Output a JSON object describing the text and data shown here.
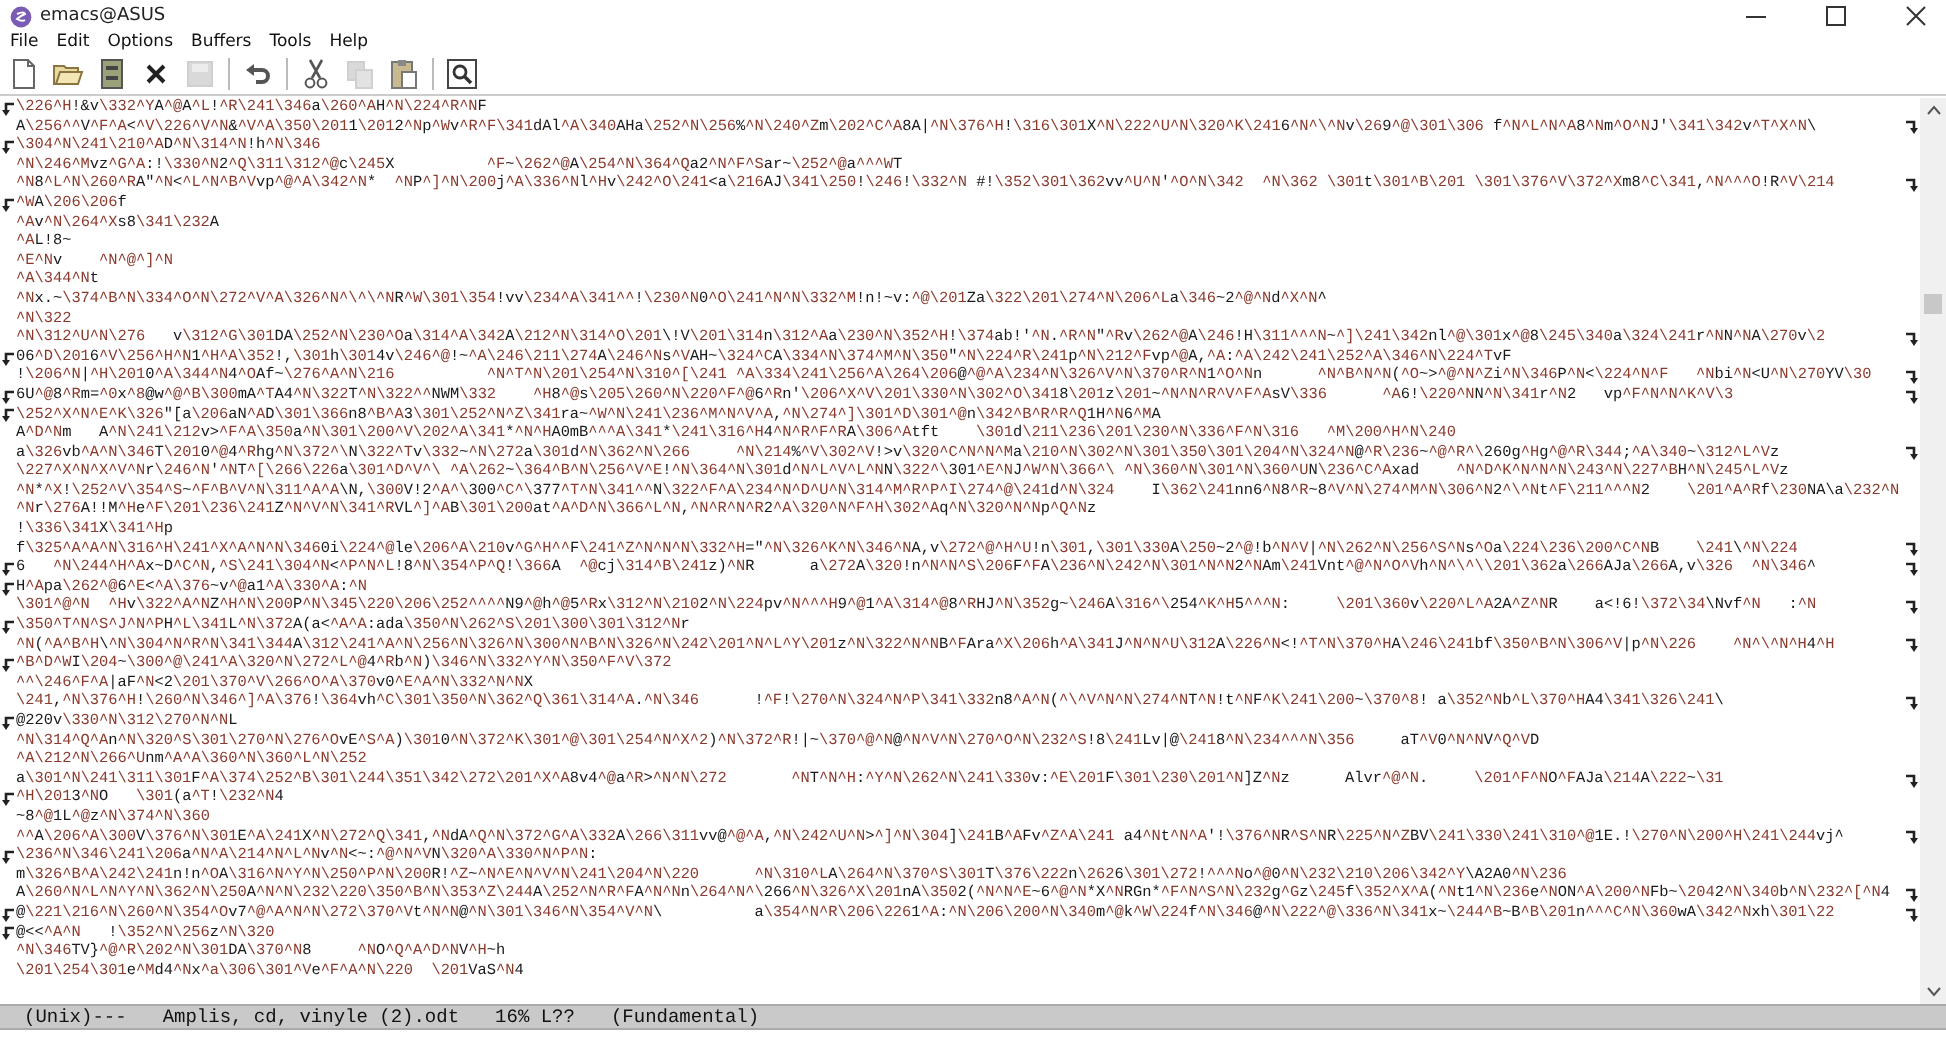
{
  "window": {
    "title": "emacs@ASUS"
  },
  "menu": [
    "File",
    "Edit",
    "Options",
    "Buffers",
    "Tools",
    "Help"
  ],
  "toolbar": [
    [
      {
        "kind": "new-file",
        "disabled": false
      },
      {
        "kind": "open",
        "disabled": false
      },
      {
        "kind": "dired",
        "disabled": false
      },
      {
        "kind": "kill",
        "disabled": false
      },
      {
        "kind": "save",
        "disabled": true
      }
    ],
    [
      {
        "kind": "undo",
        "disabled": false
      }
    ],
    [
      {
        "kind": "cut",
        "disabled": false
      },
      {
        "kind": "copy",
        "disabled": true
      },
      {
        "kind": "paste",
        "disabled": false
      }
    ],
    [
      {
        "kind": "search",
        "disabled": false
      }
    ]
  ],
  "buffer": {
    "lines": [
      {
        "text": "\\226^H!&v\\332^YA^@A^L!^R\\241\\346a\\260^AH^N\\224^R^NF",
        "wrap_left": true,
        "wrap_right": false
      },
      {
        "text": "A\\256^^V^F^A<^V\\226^V^N&^V^A\\350\\2011\\2012^Np^Wv^R^F\\341dAl^A\\340AHa\\252^N\\256%^N\\240^Zm\\202^C^A8A|^N\\376^H!\\316\\301X^N\\222^U^N\\320^K\\2416^N^\\^Nv\\269^@\\301\\306 f^N^L^N^A8^Nm^O^NJ'\\341\\342v^T^X^N\\",
        "wrap_left": false,
        "wrap_right": true
      },
      {
        "text": "\\304^N\\241\\210^AD^N\\314^N!h^N\\346",
        "wrap_left": true,
        "wrap_right": false
      },
      {
        "text": "^N\\246^Mvz^G^A:!\\330^N2^Q\\311\\312^@c\\245X          ^F~\\262^@A\\254^N\\364^Qa2^N^F^Sar~\\252^@a^^^WT",
        "wrap_left": false,
        "wrap_right": false
      },
      {
        "text": "^N8^L^N\\260^RA\"^N<^L^N^B^Vvp^@^A\\342^N*  ^NP^]^N\\200j^A\\336^Nl^Hv\\242^O\\241<a\\216AJ\\341\\250!\\246!\\332^N #!\\352\\301\\362vv^U^N'^O^N\\342  ^N\\362 \\301t\\301^B\\201 \\301\\376^V\\372^Xm8^C\\341,^N^^^O!R^V\\214",
        "wrap_left": false,
        "wrap_right": true
      },
      {
        "text": "^WA\\206\\206f",
        "wrap_left": true,
        "wrap_right": false
      },
      {
        "text": "^Av^N\\264^Xs8\\341\\232A",
        "wrap_left": false,
        "wrap_right": false
      },
      {
        "text": "^AL!8~",
        "wrap_left": false,
        "wrap_right": false
      },
      {
        "text": "^E^Nv    ^N^@^]^N",
        "wrap_left": false,
        "wrap_right": false
      },
      {
        "text": "^A\\344^Nt",
        "wrap_left": false,
        "wrap_right": false
      },
      {
        "text": "^Nx.~\\374^B^N\\334^O^N\\272^V^A\\326^N^\\^\\^NR^W\\301\\354!vv\\234^A\\341^^!\\230^N0^O\\241^N^N\\332^M!n!~v:^@\\201Za\\322\\201\\274^N\\206^La\\346~2^@^Nd^X^N^",
        "wrap_left": false,
        "wrap_right": false
      },
      {
        "text": "^N\\322",
        "wrap_left": false,
        "wrap_right": false
      },
      {
        "text": "^N\\312^U^N\\276   v\\312^G\\301DA\\252^N\\230^Oa\\314^A\\342A\\212^N\\314^O\\201\\!V\\201\\314n\\312^Aa\\230^N\\352^H!\\374ab!'^N.^R^N\"^Rv\\262^@A\\246!H\\311^^^N~^]\\241\\342nl^@\\301x^@8\\245\\340a\\324\\241r^NN^NA\\270v\\2",
        "wrap_left": false,
        "wrap_right": true
      },
      {
        "text": "06^D\\2016^V\\256^H^N1^H^A\\352!,\\301h\\3014v\\246^@!~^A\\246\\211\\274A\\246^Ns^VAH~\\324^CA\\334^N\\374^M^N\\350\"^N\\224^R\\241p^N\\212^Fvp^@A,^A:^A\\242\\241\\252^A\\346^N\\224^TvF",
        "wrap_left": true,
        "wrap_right": false
      },
      {
        "text": "!\\206^N|^H\\2010^A\\344^N4^OAf~\\276^A^N\\216          ^N^T^N\\201\\254^N\\310^[\\241 ^A\\334\\241\\256^A\\264\\206@^@^A\\234^N\\326^V^N\\370^R^N1^O^Nn      ^N^B^N^N(^O~>^@^N^Zi^N\\346P^N<\\224^N^F   ^Nbi^N<U^N\\270YV\\30",
        "wrap_left": false,
        "wrap_right": true
      },
      {
        "text": "6U^@8^Rm=^0x^8@w^@^B\\300mA^TA4^N\\322T^N\\322^^NWM\\332    ^H8^@s\\205\\260^N\\220^F^@6^Rn'\\206^X^V\\201\\330^N\\302^O\\3418\\201z\\201~^N^N^R^V^F^AsV\\336      ^A6!\\220^NN^N\\341r^N2   vp^F^N^N^K^V\\3",
        "wrap_left": true,
        "wrap_right": true
      },
      {
        "text": "\\252^X^N^E^K\\326\"[a\\206aN^AD\\301\\366n8^B^A3\\301\\252^N^Z\\341ra~^W^N\\241\\236^M^N^V^A,^N\\274^]\\301^D\\301^@n\\342^B^R^R^Q1H^N6^MA",
        "wrap_left": true,
        "wrap_right": false
      },
      {
        "text": "A^D^Nm   A^N\\241\\212v>^F^A\\350a^N\\301\\200^V\\202^A\\341*^N^HA0mB^^^A\\341*\\241\\316^H4^N^R^F^RA\\306^Atft    \\301d\\211\\236\\201\\230^N\\336^F^N\\316   ^M\\200^H^N\\240",
        "wrap_left": false,
        "wrap_right": false
      },
      {
        "text": "a\\326vb^A^N\\346T\\2010^@4^Rhg^N\\372^\\N\\322^Tv\\332~^N\\272a\\301d^N\\362^N\\266     ^N\\214%^V\\302^V!>v\\320^C^N^N^Ma\\210^N\\302^N\\301\\350\\301\\204^N\\324^N@^R\\236~^@^R^\\260g^Hg^@^R\\344;^A\\340~\\312^L^Vz",
        "wrap_left": false,
        "wrap_right": true
      },
      {
        "text": "\\227^X^N^X^V^Nr\\246^N'^NT^[\\266\\226a\\301^D^V^\\ ^A\\262~\\364^B^N\\256^V^E!^N\\364^N\\301d^N^L^V^L^NN\\322^\\301^E^NJ^W^N\\366^\\ ^N\\360^N\\301^N\\360^UN\\236^C^Axad    ^N^D^K^N^N^N\\243^N\\227^BH^N\\245^L^Vz",
        "wrap_left": false,
        "wrap_right": false
      },
      {
        "text": "^N*^X!\\252^V\\354^S~^F^B^V^N\\311^A^A\\N,\\300V!2^A^\\300^C^\\377^T^N\\341^^N\\322^F^A\\234^N^D^U^N\\314^M^R^P^I\\274^@\\241d^N\\324    I\\362\\241nn6^N8^R~8^V^N\\274^M^N\\306^N2^\\^Nt^F\\211^^^N2    \\201^A^Rf\\230NA\\a\\232^N",
        "wrap_left": false,
        "wrap_right": false
      },
      {
        "text": "^Nr\\276A!!M^He^F\\201\\236\\241Z^N^V^N\\341^RVL^]^AB\\301\\200at^A^D^N\\366^L^N,^N^R^N^R2^A\\320^N^F^H\\302^Aq^N\\320^N^Np^Q^Nz",
        "wrap_left": false,
        "wrap_right": false
      },
      {
        "text": "!\\336\\341X\\341^Hp",
        "wrap_left": false,
        "wrap_right": false
      },
      {
        "text": "f\\325^A^A^N\\316^H\\241^X^A^N^N\\3460i\\224^@le\\206^A\\210v^G^H^^F\\241^Z^N^N^N\\332^H=\"^N\\326^K^N\\346^NA,v\\272^@^H^U!n\\301,\\301\\330A\\250~2^@!b^N^V|^N\\262^N\\256^S^Ns^Oa\\224\\236\\200^C^NB    \\241\\^N\\224",
        "wrap_left": false,
        "wrap_right": true
      },
      {
        "text": "6   ^N\\244^H^Ax~D^C^N,^S\\241\\304^N<^P^N^L!8^N\\354^P^Q!\\366A  ^@cj\\314^B\\241z)^NR      a\\272A\\320!n^N^N^S\\206F^FA\\236^N\\242^N\\301^N^N2^NAm\\241Vnt^@^N^O^Vh^N^\\^\\\\201\\362a\\266AJa\\266A,v\\326  ^N\\346^",
        "wrap_left": true,
        "wrap_right": true
      },
      {
        "text": "H^Apa\\262^@6^E<^A\\376~v^@a1^A\\330^A:^N",
        "wrap_left": true,
        "wrap_right": false
      },
      {
        "text": "\\301^@^N  ^Hv\\322^A^NZ^H^N\\200P^N\\345\\220\\206\\252^^^^N9^@h^@5^Rx\\312^N\\2102^N\\224pv^N^^^H9^@1^A\\314^@8^RHJ^N\\352g~\\246A\\316^\\254^K^H5^^^N:     \\201\\360v\\220^L^A2A^Z^NR    a<!6!\\372\\34\\Nvf^N   :^N",
        "wrap_left": false,
        "wrap_right": true
      },
      {
        "text": "\\350^T^N^S^J^N^PH^L\\341L^N\\372A(a<^A^A:ada\\350^N\\262^S\\201\\300\\301\\312^Nr",
        "wrap_left": true,
        "wrap_right": false
      },
      {
        "text": "^N(^A^B^H\\^N\\304^N^R^N\\341\\344A\\312\\241^A^N\\256^N\\326^N\\300^N^B^N\\326^N\\242\\201^N^L^Y\\201z^N\\322^N^NB^FAra^X\\206h^A\\341J^N^N^U\\312A\\226^N<!^T^N\\370^HA\\246\\241bf\\350^B^N\\306^V|p^N\\226    ^N^\\^N^H4^H",
        "wrap_left": false,
        "wrap_right": true
      },
      {
        "text": "^B^D^WI\\204~\\300^@\\241^A\\320^N\\272^L^@4^Rb^N)\\346^N\\332^Y^N\\350^F^V\\372",
        "wrap_left": true,
        "wrap_right": false
      },
      {
        "text": "^^\\246^F^A|aF^N<2\\201\\370^V\\266^O^A\\370v0^E^A^N\\332^N^NX",
        "wrap_left": false,
        "wrap_right": false
      },
      {
        "text": "\\241,^N\\376^H!\\260^N\\346^]^A\\376!\\364vh^C\\301\\350^N\\362^Q\\361\\314^A.^N\\346      !^F!\\270^N\\324^N^P\\341\\332n8^A^N(^\\^V^N^N\\274^NT^N!t^NF^K\\241\\200~\\370^8! a\\352^Nb^L\\370^HA4\\341\\326\\241\\",
        "wrap_left": false,
        "wrap_right": true
      },
      {
        "text": "@220v\\330^N\\312\\270^N^NL",
        "wrap_left": true,
        "wrap_right": false
      },
      {
        "text": "^N\\314^Q^An^N\\320^S\\301\\270^N\\276^OvE^S^A)\\3010^N\\372^K\\301^@\\301\\254^N^X^2)^N\\372^R!|~\\370^@^N@^N^V^N\\270^O^N\\232^S!8\\241Lv|@\\2418^N\\234^^^N\\356     aT^V0^N^NV^Q^VD",
        "wrap_left": false,
        "wrap_right": false
      },
      {
        "text": "^A\\212^N\\266^Unm^A^A\\360^N\\360^L^N\\252",
        "wrap_left": false,
        "wrap_right": false
      },
      {
        "text": "a\\301^N\\241\\311\\301F^A\\374\\252^B\\301\\244\\351\\342\\272\\201^X^A8v4^@a^R>^N^N\\272       ^NT^N^H:^Y^N\\262^N\\241\\330v:^E\\201F\\301\\230\\201^N]Z^Nz      Alvr^@^N.     \\201^F^NO^FAJa\\214A\\222~\\31",
        "wrap_left": false,
        "wrap_right": true
      },
      {
        "text": "^H\\2013^NO   \\301(a^T!\\232^N4",
        "wrap_left": true,
        "wrap_right": false
      },
      {
        "text": "~8^@1L^@z^N\\374^N\\360",
        "wrap_left": false,
        "wrap_right": false
      },
      {
        "text": "^^A\\206^A\\300V\\376^N\\301E^A\\241X^N\\272^Q\\341,^NdA^Q^N\\372^G^A\\332A\\266\\311vv@^@^A,^N\\242^U^N>^]^N\\304]\\241B^AFv^Z^A\\241 a4^Nt^N^A'!\\376^NR^S^NR\\225^N^ZBV\\241\\330\\241\\310^@1E.!\\270^N\\200^H\\241\\244vj^",
        "wrap_left": false,
        "wrap_right": true
      },
      {
        "text": "\\236^N\\346\\241\\206a^N^A\\214^N^L^Nv^N<~:^@^N^VN\\320^A\\330^N^P^N:",
        "wrap_left": true,
        "wrap_right": false
      },
      {
        "text": "m\\326^B^A\\242\\241n!n^OA\\316^N^Y^N\\250^P^N\\200R!^Z~^N^E^N^V^N\\241\\204^N\\220      ^N\\310^LA\\264^N\\370^S\\301T\\376\\222n\\2626\\301\\272!^^^No^@0^N\\232\\210\\206\\342^Y\\A2A0^N\\236",
        "wrap_left": false,
        "wrap_right": false
      },
      {
        "text": "A\\260^N^L^N^Y^N\\362^N\\250A^N^N\\232\\220\\350^B^N\\353^Z\\244A\\252^N^R^FA^N^Nn\\264^N^\\266^N\\326^X\\201nA\\3502(^N^N^E~6^@^N*X^NRGn*^F^N^S^N\\232g^Gz\\245f\\352^X^A(^Nt1^N\\236e^NON^A\\200^NFb~\\2042^N\\340b^N\\232^[^N4",
        "wrap_left": false,
        "wrap_right": true
      },
      {
        "text": "@\\221\\216^N\\260^N\\354^Ov7^@^A^N^N\\272\\370^Vt^N^N@^N\\301\\346^N\\354^V^N\\          a\\354^N^R\\206\\2261^A:^N\\206\\200^N\\340m^@k^W\\224f^N\\346@^N\\222^@\\336^N\\341x~\\244^B~B^B\\201n^^^C^N\\360wA\\342^Nxh\\301\\22",
        "wrap_left": true,
        "wrap_right": true
      },
      {
        "text": "@<<^A^N   !\\352^N\\256z^N\\320",
        "wrap_left": true,
        "wrap_right": false
      },
      {
        "text": "^N\\346TV}^@^R\\202^N\\301DA\\370^N8     ^NO^Q^A^D^NV^H~h",
        "wrap_left": false,
        "wrap_right": false
      },
      {
        "text": "\\201\\254\\301e^Md4^Nx^a\\306\\301^Ve^F^A^N\\220  \\201VaS^N4",
        "wrap_left": false,
        "wrap_right": false
      }
    ]
  },
  "mode_line": {
    "coding": "(Unix)---",
    "buffer_name": "Amplis, cd, vinyle (2).odt",
    "position": "16% L??",
    "mode": "(Fundamental)"
  }
}
